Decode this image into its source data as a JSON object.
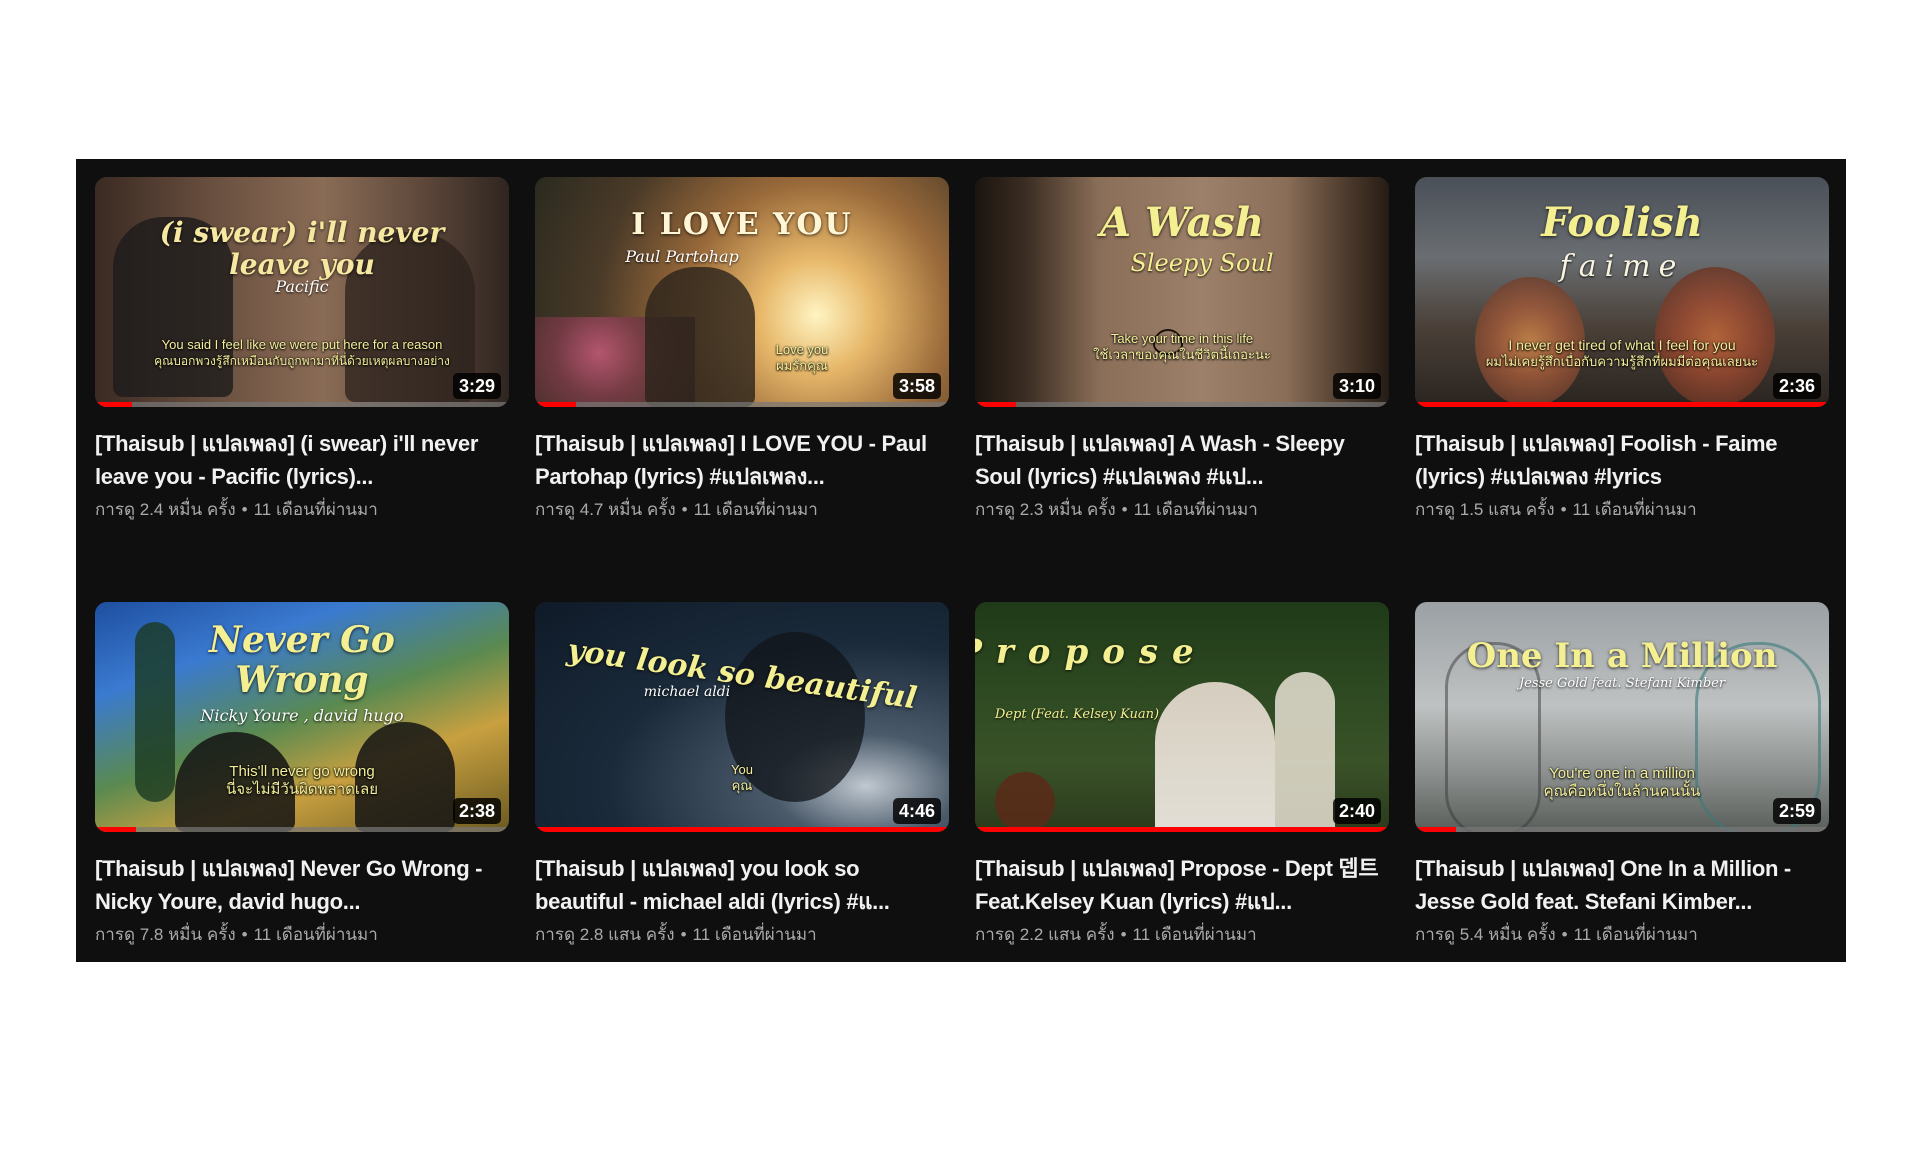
{
  "videos": [
    {
      "title": "[Thaisub | แปลเพลง] (i swear) i'll never leave you - Pacific (lyrics)...",
      "views": "การดู 2.4 หมื่น ครั้ง",
      "age": "11 เดือนที่ผ่านมา",
      "duration": "3:29",
      "watched_fraction": 0.09,
      "thumb_heading": "(i swear) i'll never leave you",
      "thumb_artist": "Pacific",
      "thumb_lyric_1": "You said I feel like we were put here for a reason",
      "thumb_lyric_2": "คุณบอกพวงรู้สึกเหมือนกับถูกพามาที่นี่ด้วยเหตุผลบางอย่าง"
    },
    {
      "title": "[Thaisub | แปลเพลง] I LOVE YOU - Paul Partohap (lyrics) #แปลเพลง...",
      "views": "การดู 4.7 หมื่น ครั้ง",
      "age": "11 เดือนที่ผ่านมา",
      "duration": "3:58",
      "watched_fraction": 0.1,
      "thumb_heading": "I LOVE YOU",
      "thumb_artist": "Paul Partohap",
      "thumb_lyric_1": "Love you",
      "thumb_lyric_2": "ผมรักคุณ"
    },
    {
      "title": "[Thaisub | แปลเพลง] A Wash - Sleepy Soul (lyrics) #แปลเพลง #แป...",
      "views": "การดู 2.3 หมื่น ครั้ง",
      "age": "11 เดือนที่ผ่านมา",
      "duration": "3:10",
      "watched_fraction": 0.1,
      "thumb_heading": "A Wash",
      "thumb_artist": "Sleepy Soul",
      "thumb_lyric_1": "Take your time in this life",
      "thumb_lyric_2": "ใช้เวลาของคุณในชีวิตนี้เถอะนะ"
    },
    {
      "title": "[Thaisub | แปลเพลง] Foolish - Faime (lyrics) #แปลเพลง #lyrics",
      "views": "การดู 1.5 แสน ครั้ง",
      "age": "11 เดือนที่ผ่านมา",
      "duration": "2:36",
      "watched_fraction": 1.0,
      "thumb_heading": "Foolish",
      "thumb_artist": "faime",
      "thumb_lyric_1": "I never get tired of what I feel for you",
      "thumb_lyric_2": "ผมไม่เคยรู้สึกเบื่อกับความรู้สึกที่ผมมีต่อคุณเลยนะ"
    },
    {
      "title": "[Thaisub | แปลเพลง] Never Go Wrong - Nicky Youre, david hugo...",
      "views": "การดู 7.8 หมื่น ครั้ง",
      "age": "11 เดือนที่ผ่านมา",
      "duration": "2:38",
      "watched_fraction": 0.1,
      "thumb_heading": "Never Go Wrong",
      "thumb_artist": "Nicky Youre , david hugo",
      "thumb_lyric_1": "This'll never go wrong",
      "thumb_lyric_2": "นี่จะไม่มีวันผิดพลาดเลย"
    },
    {
      "title": "[Thaisub | แปลเพลง] you look so beautiful - michael aldi (lyrics) #แ...",
      "views": "การดู 2.8 แสน ครั้ง",
      "age": "11 เดือนที่ผ่านมา",
      "duration": "4:46",
      "watched_fraction": 1.0,
      "thumb_heading": "you look so beautiful",
      "thumb_artist": "michael aldi",
      "thumb_lyric_1": "You",
      "thumb_lyric_2": "คุณ"
    },
    {
      "title": "[Thaisub | แปลเพลง] Propose - Dept 뎁트 Feat.Kelsey Kuan (lyrics) #แป...",
      "views": "การดู 2.2 แสน ครั้ง",
      "age": "11 เดือนที่ผ่านมา",
      "duration": "2:40",
      "watched_fraction": 1.0,
      "thumb_heading": "Propose",
      "thumb_artist": "Dept (Feat. Kelsey Kuan)",
      "thumb_lyric_1": "",
      "thumb_lyric_2": ""
    },
    {
      "title": "[Thaisub | แปลเพลง] One In a Million - Jesse Gold feat. Stefani Kimber...",
      "views": "การดู 5.4 หมื่น ครั้ง",
      "age": "11 เดือนที่ผ่านมา",
      "duration": "2:59",
      "watched_fraction": 0.1,
      "thumb_heading": "One In a Million",
      "thumb_artist": "Jesse Gold feat. Stefani Kimber",
      "thumb_lyric_1": "You're one in a million",
      "thumb_lyric_2": "คุณคือหนึ่งในล้านคนนั้น"
    }
  ],
  "colors": {
    "background": "#0f0f0f",
    "title": "#f1f1f1",
    "meta": "#aaaaaa",
    "progress": "#ff0000"
  }
}
